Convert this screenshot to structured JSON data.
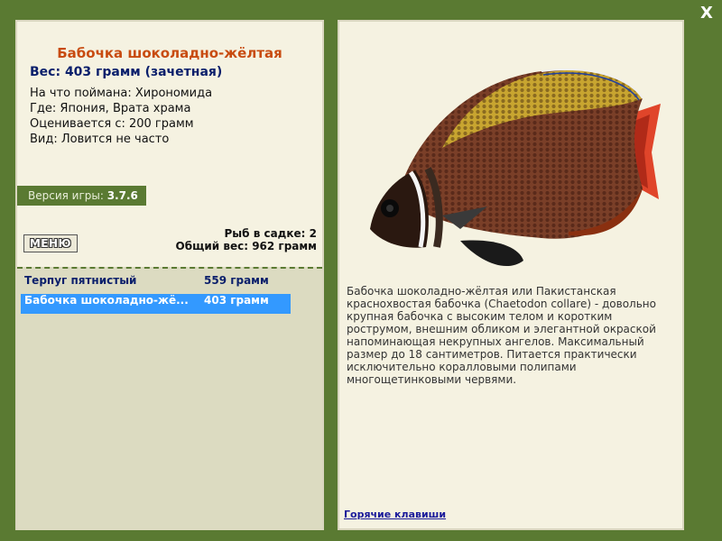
{
  "window": {
    "close_label": "X"
  },
  "fish": {
    "title": "Бабочка шоколадно-жёлтая",
    "weight": "Вес: 403 грамм (зачетная)",
    "caught_on": "На что поймана: Хирономида",
    "location": "Где: Япония, Врата храма",
    "valued_from": "Оценивается с: 200 грамм",
    "rarity": "Вид: Ловится не часто"
  },
  "version": {
    "label": "Версия игры: ",
    "value": "3.7.6"
  },
  "menu": {
    "label": "МЕНЮ"
  },
  "keepnet": {
    "count": "Рыб в садке: 2",
    "total_weight": "Общий вес: 962 грамм",
    "items": [
      {
        "name": "Терпуг пятнистый",
        "weight": "559 грамм"
      },
      {
        "name": "Бабочка шоколадно-жё...",
        "weight": "403 грамм"
      }
    ]
  },
  "description": "Бабочка шоколадно-жёлтая или Пакистанская краснохвостая бабочка (Chaetodon collare) - довольно крупная бабочка с высоким телом и коротким рострумом, внешним обликом и элегантной окраской напоминающая некрупных ангелов. Максимальный размер до 18 сантиметров. Питается практически исключительно коралловыми полипами многощетинковыми червями.",
  "hotkeys_link": "Горячие клавиши",
  "colors": {
    "frame": "#5a7a32",
    "panel": "#f5f2e1",
    "list_bg": "#dcdbc1",
    "title": "#c84b10",
    "selected": "#3399ff"
  },
  "icons": [
    "close-icon",
    "fish-image"
  ]
}
